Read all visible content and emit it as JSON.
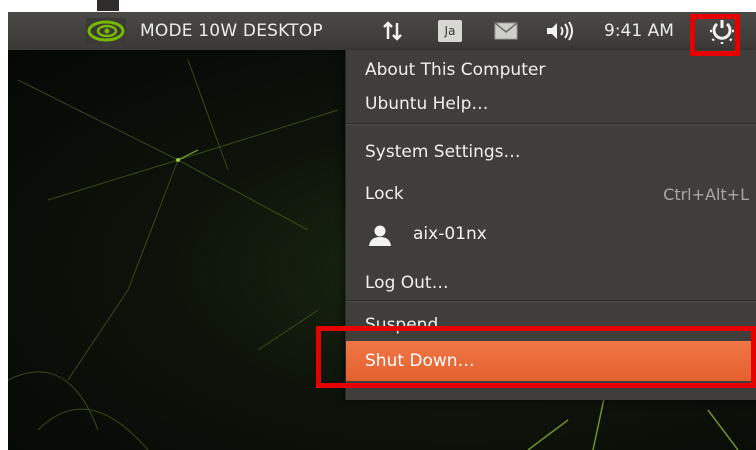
{
  "panel": {
    "mode_label": "MODE 10W DESKTOP",
    "clock": "9:41 AM",
    "keyboard_indicator": "Ja",
    "icons": [
      "nvidia-logo",
      "network",
      "keyboard-layout",
      "mail",
      "volume",
      "power-gear"
    ]
  },
  "menu": {
    "items": [
      {
        "label": "About This Computer"
      },
      {
        "label": "Ubuntu Help…"
      },
      {
        "label": "System Settings…"
      },
      {
        "label": "Lock",
        "shortcut": "Ctrl+Alt+L"
      },
      {
        "label": "aix-01nx"
      },
      {
        "label": "Log Out…"
      },
      {
        "label": "Suspend"
      },
      {
        "label": "Shut Down…",
        "highlighted": true
      }
    ]
  },
  "colors": {
    "panel": "#3f3e3a",
    "menu_bg": "#3f3e3a",
    "highlight": "#e9683a",
    "annotation_box": "#e60000",
    "nvidia_green": "#76b900"
  }
}
